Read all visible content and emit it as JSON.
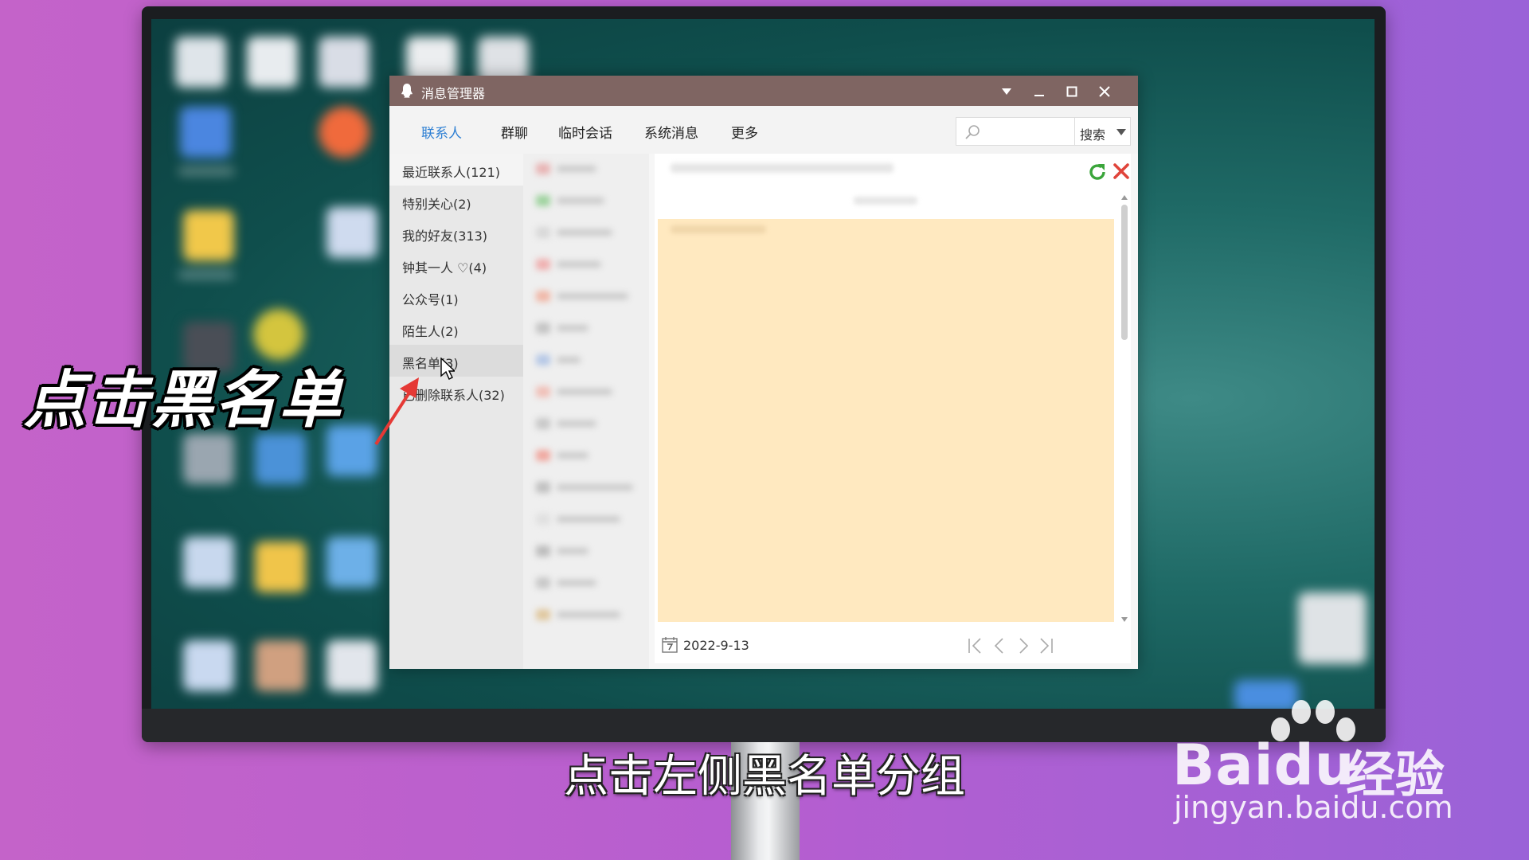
{
  "window": {
    "title": "消息管理器",
    "tabs": [
      "联系人",
      "群聊",
      "临时会话",
      "系统消息",
      "更多"
    ],
    "active_tab": 0,
    "search": {
      "placeholder": "",
      "button_label": "搜索"
    }
  },
  "sidebar": {
    "items": [
      {
        "label": "最近联系人(121)"
      },
      {
        "label": "特别关心(2)"
      },
      {
        "label": "我的好友(313)"
      },
      {
        "label": "钟其一人 ♡(4)"
      },
      {
        "label": "公众号(1)"
      },
      {
        "label": "陌生人(2)"
      },
      {
        "label": "黑名单(3)"
      },
      {
        "label": "已删除联系人(32)"
      }
    ],
    "selected_index": 6
  },
  "main": {
    "date": "2022-9-13"
  },
  "overlay": {
    "big_caption": "点击黑名单",
    "subtitle": "点击左侧黑名单分组"
  },
  "watermark": {
    "logo": "Baidu",
    "cn": "经验",
    "url": "jingyan.baidu.com"
  },
  "colors": {
    "titlebar": "#7f6562",
    "accent_tab": "#2d7fd3",
    "message_bg": "#ffe9c0",
    "background": "#b65ed0",
    "arrow": "#e53935"
  }
}
